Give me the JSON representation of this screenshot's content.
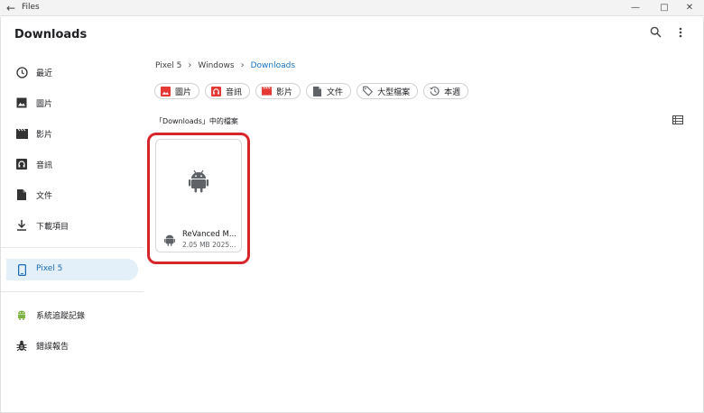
{
  "window": {
    "title": "Files"
  },
  "app": {
    "title": "Downloads"
  },
  "sidebar": {
    "items": [
      {
        "label": "最近",
        "icon": "clock-icon"
      },
      {
        "label": "圖片",
        "icon": "image-icon"
      },
      {
        "label": "影片",
        "icon": "clapperboard-icon"
      },
      {
        "label": "音訊",
        "icon": "audio-icon"
      },
      {
        "label": "文件",
        "icon": "document-icon"
      },
      {
        "label": "下載項目",
        "icon": "download-icon"
      }
    ],
    "device": {
      "label": "Pixel 5",
      "icon": "phone-icon"
    },
    "extras": [
      {
        "label": "系統追蹤記錄",
        "icon": "android-icon"
      },
      {
        "label": "錯誤報告",
        "icon": "bug-icon"
      }
    ]
  },
  "breadcrumb": [
    "Pixel 5",
    "Windows",
    "Downloads"
  ],
  "chips": [
    {
      "label": "圖片",
      "icon": "image-icon",
      "color": "#e53935"
    },
    {
      "label": "音訊",
      "icon": "audio-icon",
      "color": "#e53935"
    },
    {
      "label": "影片",
      "icon": "video-icon",
      "color": "#e53935"
    },
    {
      "label": "文件",
      "icon": "document-icon",
      "color": "#5f6368"
    },
    {
      "label": "大型檔案",
      "icon": "tag-icon",
      "color": "#5f6368"
    },
    {
      "label": "本週",
      "icon": "history-icon",
      "color": "#5f6368"
    }
  ],
  "content": {
    "section_label": "「Downloads」中的檔案",
    "files": [
      {
        "name": "ReVanced M...",
        "meta": "2.05 MB 2025...",
        "icon": "android-icon"
      }
    ]
  },
  "colors": {
    "accent": "#1a73c0",
    "active_bg": "#e3eff9",
    "highlight": "#d6262c"
  }
}
